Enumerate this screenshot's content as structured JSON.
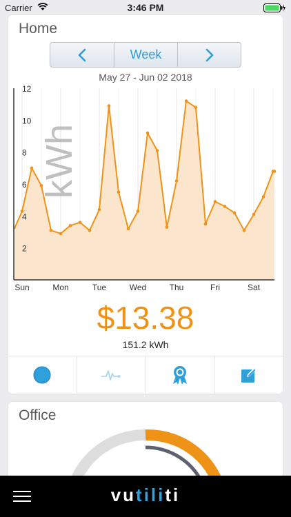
{
  "status_bar": {
    "carrier": "Carrier",
    "time": "3:46 PM"
  },
  "home_card": {
    "title": "Home",
    "segment": {
      "prev_label": "‹",
      "period_label": "Week",
      "next_label": "›"
    },
    "date_range": "May 27 - Jun 02 2018",
    "cost": "$13.38",
    "total_kwh": "151.2 kWh",
    "actions": [
      {
        "icon": "record-dot-icon",
        "active": true
      },
      {
        "icon": "pulse-icon",
        "active": false
      },
      {
        "icon": "award-ribbon-icon",
        "active": true
      },
      {
        "icon": "edit-note-icon",
        "active": true
      }
    ]
  },
  "office_card": {
    "title": "Office"
  },
  "tabbar": {
    "logo_prefix": "vu",
    "logo_accent": "tili",
    "logo_suffix": "ti"
  },
  "colors": {
    "accent_orange": "#ef9318",
    "accent_blue": "#2e9ad6",
    "area_fill": "#fbe5cc"
  },
  "chart_data": {
    "type": "area",
    "ylabel": "kWh",
    "ylim": [
      0,
      12
    ],
    "yticks": [
      2,
      4,
      6,
      8,
      10,
      12
    ],
    "xlim": [
      0,
      6.75
    ],
    "xticks": [
      {
        "x": 0,
        "label": "Sun"
      },
      {
        "x": 1,
        "label": "Mon"
      },
      {
        "x": 2,
        "label": "Tue"
      },
      {
        "x": 3,
        "label": "Wed"
      },
      {
        "x": 4,
        "label": "Thu"
      },
      {
        "x": 5,
        "label": "Fri"
      },
      {
        "x": 6,
        "label": "Sat"
      }
    ],
    "grid": "vertical",
    "series": [
      {
        "x": [
          -0.2,
          0.0,
          0.25,
          0.5,
          0.75,
          1.0,
          1.25,
          1.5,
          1.75,
          2.0,
          2.25,
          2.5,
          2.75,
          3.0,
          3.25,
          3.5,
          3.75,
          4.0,
          4.25,
          4.5,
          4.75,
          5.0,
          5.25,
          5.5,
          5.75,
          6.0,
          6.25,
          6.5,
          6.75
        ],
        "values": [
          3.2,
          4.3,
          7.0,
          5.9,
          3.1,
          2.9,
          3.4,
          3.6,
          3.1,
          4.4,
          10.9,
          5.5,
          3.2,
          4.3,
          9.2,
          8.1,
          3.3,
          6.2,
          11.2,
          10.8,
          3.5,
          4.9,
          4.6,
          4.2,
          3.1,
          4.1,
          5.2,
          6.8,
          6.8
        ]
      }
    ]
  }
}
